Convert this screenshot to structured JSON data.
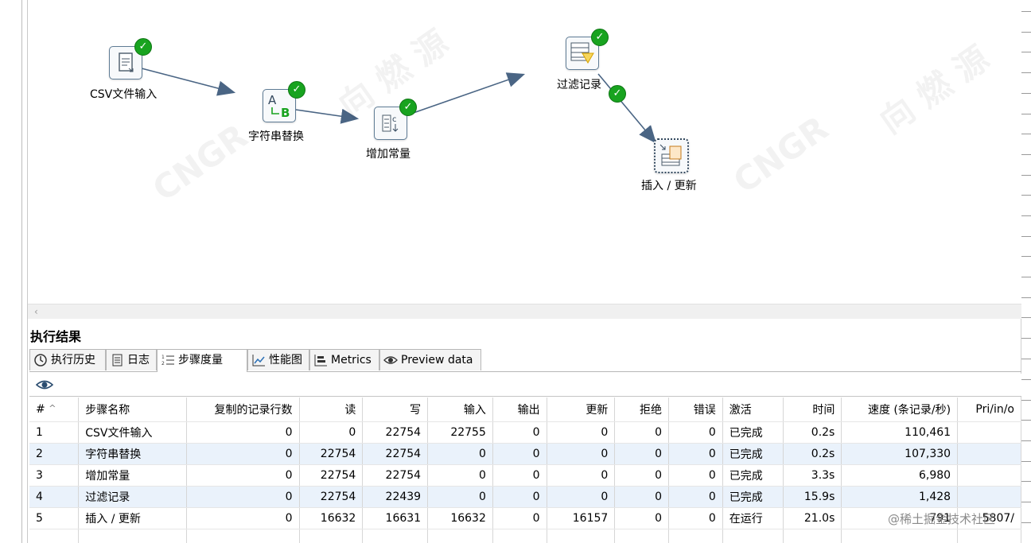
{
  "canvas": {
    "steps": [
      {
        "id": "csv",
        "label": "CSV文件输入",
        "icon": "csv-input-icon"
      },
      {
        "id": "replace",
        "label": "字符串替换",
        "icon": "string-replace-icon"
      },
      {
        "id": "constant",
        "label": "增加常量",
        "icon": "add-constant-icon"
      },
      {
        "id": "filter",
        "label": "过滤记录",
        "icon": "filter-rows-icon"
      },
      {
        "id": "upsert",
        "label": "插入 / 更新",
        "icon": "insert-update-icon"
      }
    ]
  },
  "results": {
    "title": "执行结果",
    "tabs": [
      {
        "label": "执行历史",
        "icon": "history-icon"
      },
      {
        "label": "日志",
        "icon": "log-icon"
      },
      {
        "label": "步骤度量",
        "icon": "step-metrics-icon"
      },
      {
        "label": "性能图",
        "icon": "performance-chart-icon"
      },
      {
        "label": "Metrics",
        "icon": "metrics-icon"
      },
      {
        "label": "Preview data",
        "icon": "preview-eye-icon"
      }
    ],
    "columns": [
      "#",
      "步骤名称",
      "复制的记录行数",
      "读",
      "写",
      "输入",
      "输出",
      "更新",
      "拒绝",
      "错误",
      "激活",
      "时间",
      "速度 (条记录/秒)",
      "Pri/in/o"
    ],
    "rows": [
      [
        "1",
        "CSV文件输入",
        "0",
        "0",
        "22754",
        "22755",
        "0",
        "0",
        "0",
        "0",
        "已完成",
        "0.2s",
        "110,461",
        ""
      ],
      [
        "2",
        "字符串替换",
        "0",
        "22754",
        "22754",
        "0",
        "0",
        "0",
        "0",
        "0",
        "已完成",
        "0.2s",
        "107,330",
        ""
      ],
      [
        "3",
        "增加常量",
        "0",
        "22754",
        "22754",
        "0",
        "0",
        "0",
        "0",
        "0",
        "已完成",
        "3.3s",
        "6,980",
        ""
      ],
      [
        "4",
        "过滤记录",
        "0",
        "22754",
        "22439",
        "0",
        "0",
        "0",
        "0",
        "0",
        "已完成",
        "15.9s",
        "1,428",
        ""
      ],
      [
        "5",
        "插入 / 更新",
        "0",
        "16632",
        "16631",
        "16632",
        "0",
        "16157",
        "0",
        "0",
        "在运行",
        "21.0s",
        "791",
        "5807/"
      ]
    ]
  },
  "watermark": {
    "text": "@稀土掘金技术社区"
  },
  "colors": {
    "check": "#18a31f",
    "hop": "#4a6584",
    "row_alt": "#eaf2fb"
  }
}
